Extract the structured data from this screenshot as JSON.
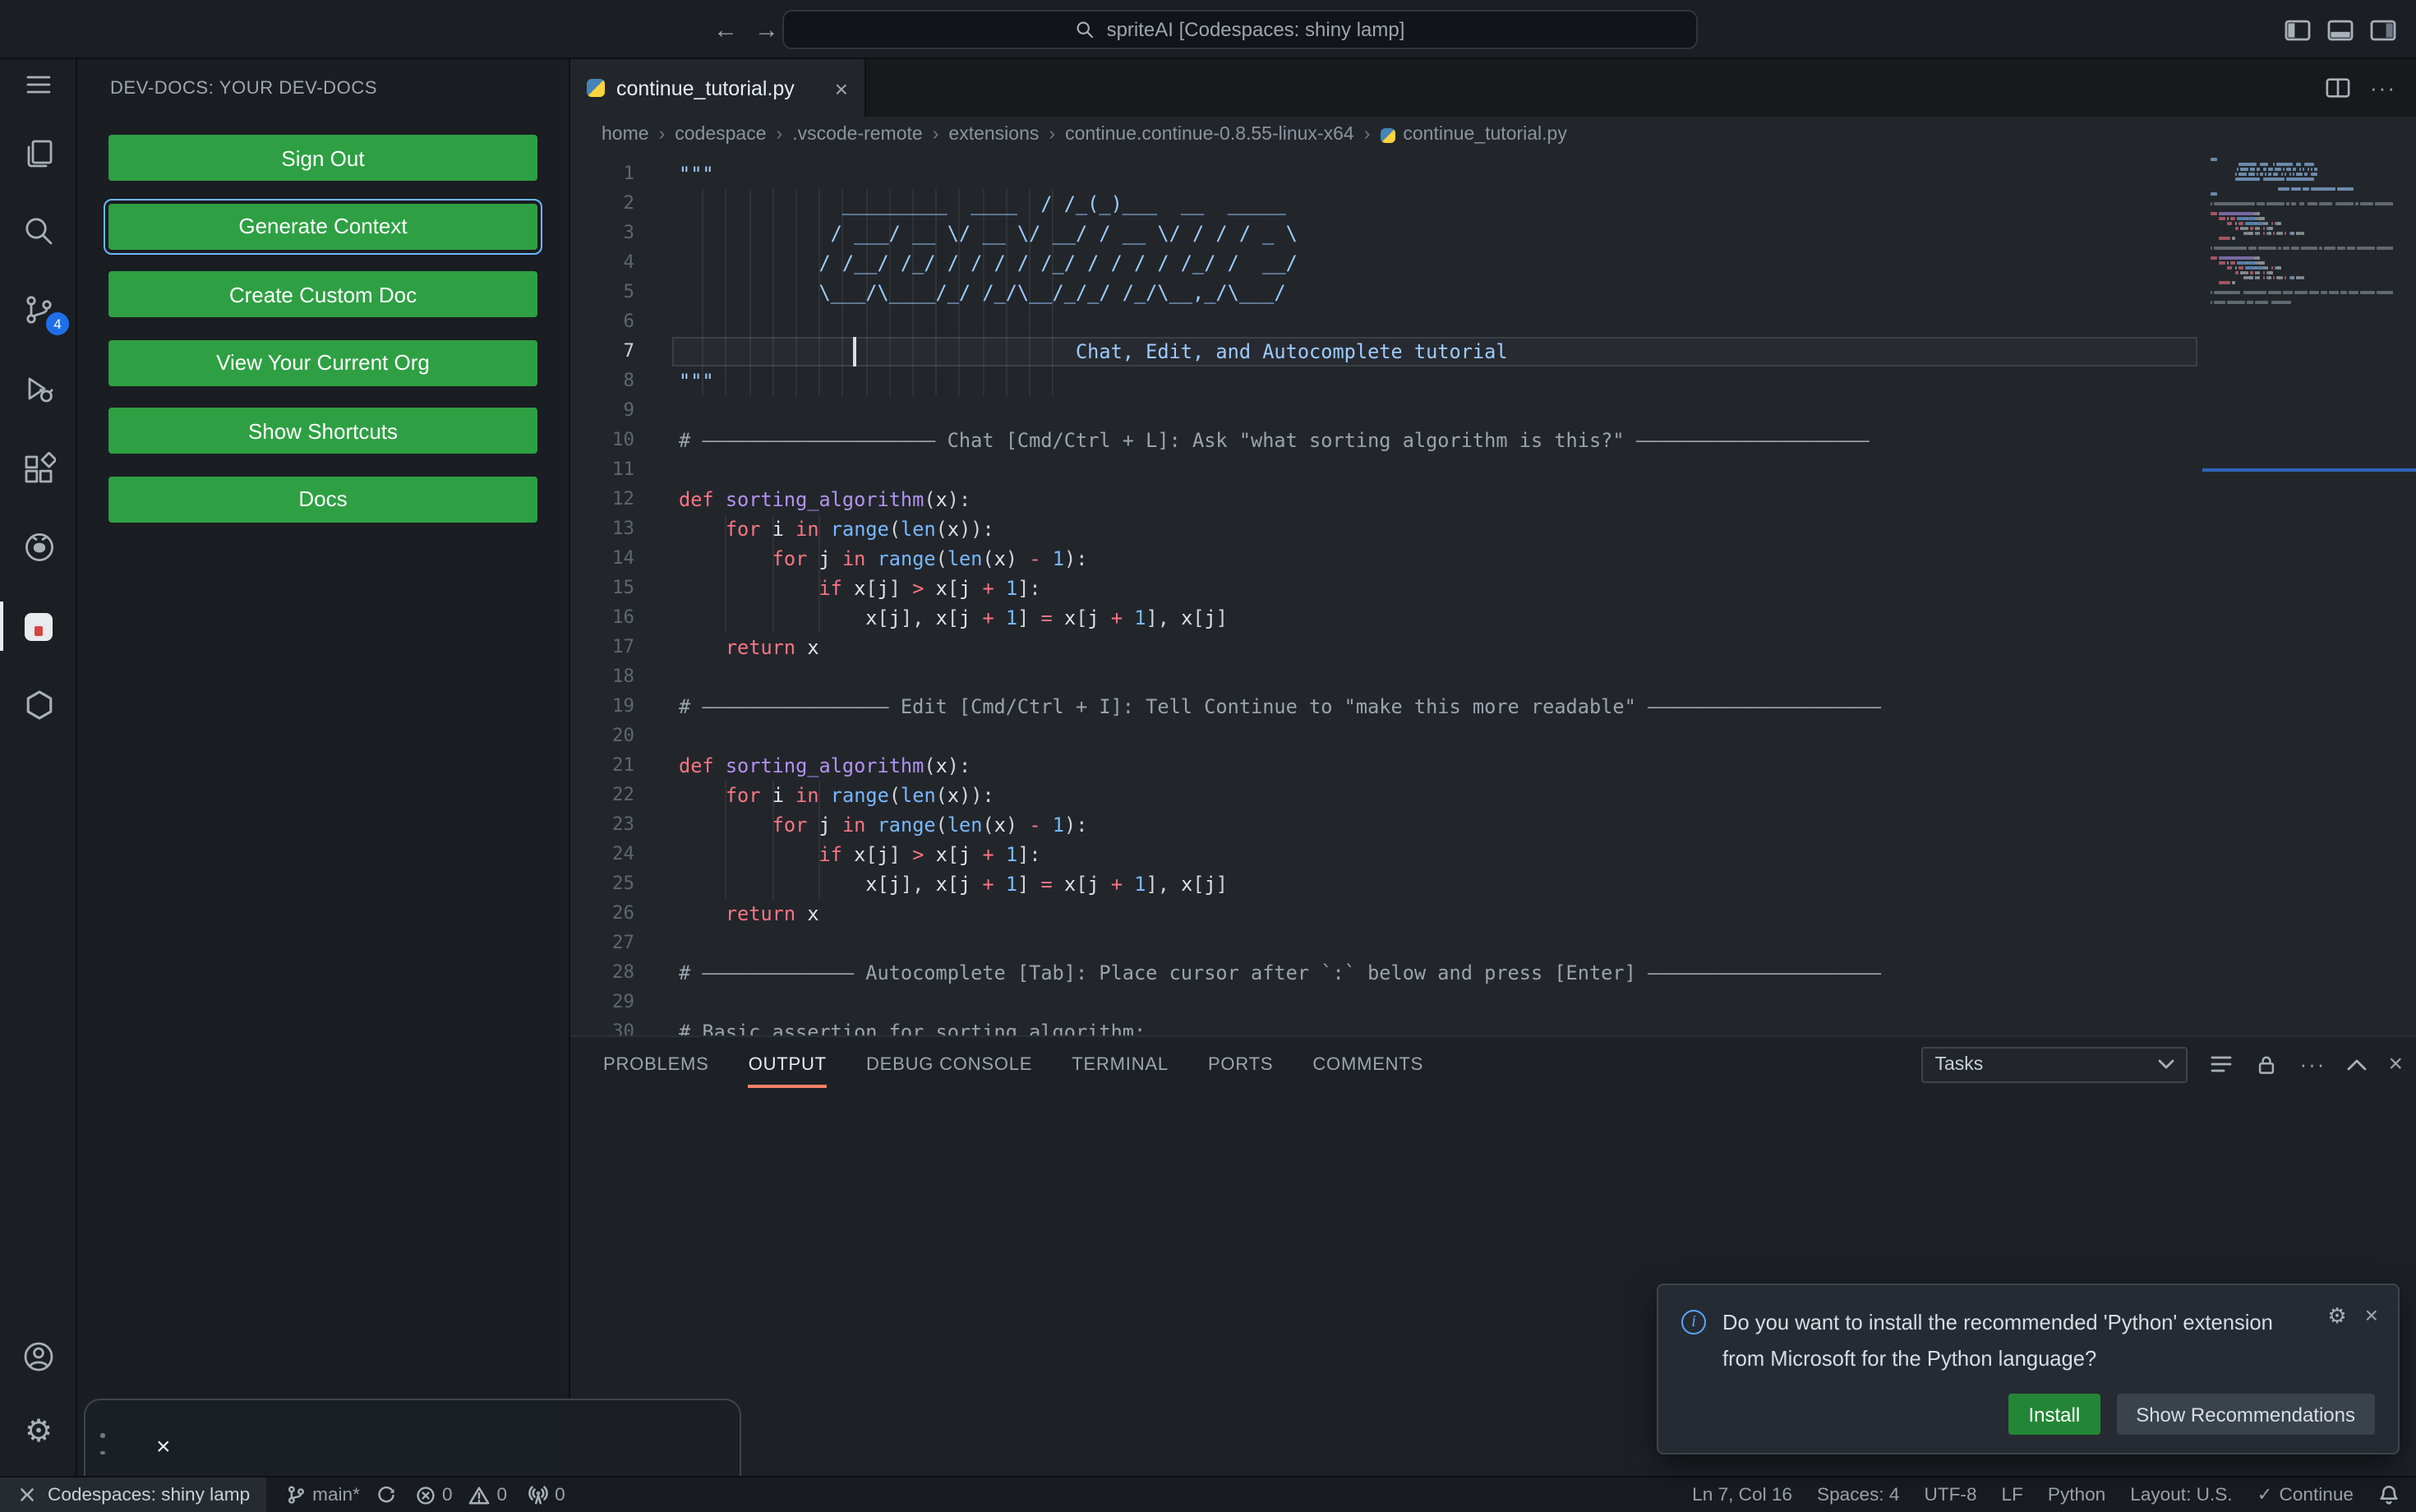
{
  "titlebar": {
    "search_value": "spriteAI [Codespaces: shiny lamp]"
  },
  "activity_bar": {
    "scm_badge": "4"
  },
  "sidebar": {
    "title": "DEV-DOCS: YOUR DEV-DOCS",
    "buttons": [
      "Sign Out",
      "Generate Context",
      "Create Custom Doc",
      "View Your Current Org",
      "Show Shortcuts",
      "Docs"
    ],
    "focused_index": 1
  },
  "editor": {
    "tab_label": "continue_tutorial.py",
    "breadcrumbs": [
      "home",
      "codespace",
      ".vscode-remote",
      "extensions",
      "continue.continue-0.8.55-linux-x64",
      "continue_tutorial.py"
    ],
    "active_line": 7,
    "cursor": {
      "line": 7,
      "col": 16
    },
    "lines": [
      [
        [
          "s",
          "\"\"\""
        ]
      ],
      [
        [
          "s",
          "              _________  ____  / /_(_)___  __  _____"
        ]
      ],
      [
        [
          "s",
          "             / ___/ __ \\/ __ \\/ __/ / __ \\/ / / / _ \\"
        ]
      ],
      [
        [
          "s",
          "            / /__/ /_/ / / / / /_/ / / / / /_/ /  __/"
        ]
      ],
      [
        [
          "s",
          "            \\___/\\____/_/ /_/\\__/_/_/ /_/\\__,_/\\___/"
        ]
      ],
      [],
      [
        [
          "s",
          "                                  Chat, Edit, and Autocomplete tutorial"
        ]
      ],
      [
        [
          "s",
          "\"\"\""
        ]
      ],
      [],
      [
        [
          "c",
          "# ———————————————————— Chat [Cmd/Ctrl + L]: Ask \"what sorting algorithm is this?\" ————————————————————"
        ]
      ],
      [],
      [
        [
          "k",
          "def"
        ],
        [
          "p",
          " "
        ],
        [
          "f",
          "sorting_algorithm"
        ],
        [
          "p",
          "("
        ],
        [
          "v",
          "x"
        ],
        [
          "p",
          "):"
        ]
      ],
      [
        [
          "p",
          "    "
        ],
        [
          "k",
          "for"
        ],
        [
          "p",
          " "
        ],
        [
          "v",
          "i"
        ],
        [
          "p",
          " "
        ],
        [
          "k",
          "in"
        ],
        [
          "p",
          " "
        ],
        [
          "b",
          "range"
        ],
        [
          "p",
          "("
        ],
        [
          "b",
          "len"
        ],
        [
          "p",
          "("
        ],
        [
          "v",
          "x"
        ],
        [
          "p",
          ")):"
        ]
      ],
      [
        [
          "p",
          "        "
        ],
        [
          "k",
          "for"
        ],
        [
          "p",
          " "
        ],
        [
          "v",
          "j"
        ],
        [
          "p",
          " "
        ],
        [
          "k",
          "in"
        ],
        [
          "p",
          " "
        ],
        [
          "b",
          "range"
        ],
        [
          "p",
          "("
        ],
        [
          "b",
          "len"
        ],
        [
          "p",
          "("
        ],
        [
          "v",
          "x"
        ],
        [
          "p",
          ") "
        ],
        [
          "o",
          "-"
        ],
        [
          "p",
          " "
        ],
        [
          "n",
          "1"
        ],
        [
          "p",
          "):"
        ]
      ],
      [
        [
          "p",
          "            "
        ],
        [
          "k",
          "if"
        ],
        [
          "p",
          " "
        ],
        [
          "v",
          "x"
        ],
        [
          "p",
          "["
        ],
        [
          "v",
          "j"
        ],
        [
          "p",
          "] "
        ],
        [
          "o",
          ">"
        ],
        [
          "p",
          " "
        ],
        [
          "v",
          "x"
        ],
        [
          "p",
          "["
        ],
        [
          "v",
          "j"
        ],
        [
          "p",
          " "
        ],
        [
          "o",
          "+"
        ],
        [
          "p",
          " "
        ],
        [
          "n",
          "1"
        ],
        [
          "p",
          "]:"
        ]
      ],
      [
        [
          "p",
          "                "
        ],
        [
          "v",
          "x"
        ],
        [
          "p",
          "["
        ],
        [
          "v",
          "j"
        ],
        [
          "p",
          "], "
        ],
        [
          "v",
          "x"
        ],
        [
          "p",
          "["
        ],
        [
          "v",
          "j"
        ],
        [
          "p",
          " "
        ],
        [
          "o",
          "+"
        ],
        [
          "p",
          " "
        ],
        [
          "n",
          "1"
        ],
        [
          "p",
          "] "
        ],
        [
          "o",
          "="
        ],
        [
          "p",
          " "
        ],
        [
          "v",
          "x"
        ],
        [
          "p",
          "["
        ],
        [
          "v",
          "j"
        ],
        [
          "p",
          " "
        ],
        [
          "o",
          "+"
        ],
        [
          "p",
          " "
        ],
        [
          "n",
          "1"
        ],
        [
          "p",
          "], "
        ],
        [
          "v",
          "x"
        ],
        [
          "p",
          "["
        ],
        [
          "v",
          "j"
        ],
        [
          "p",
          "]"
        ]
      ],
      [
        [
          "p",
          "    "
        ],
        [
          "k",
          "return"
        ],
        [
          "p",
          " "
        ],
        [
          "v",
          "x"
        ]
      ],
      [],
      [
        [
          "c",
          "# ———————————————— Edit [Cmd/Ctrl + I]: Tell Continue to \"make this more readable\" ————————————————————"
        ]
      ],
      [],
      [
        [
          "k",
          "def"
        ],
        [
          "p",
          " "
        ],
        [
          "f",
          "sorting_algorithm"
        ],
        [
          "p",
          "("
        ],
        [
          "v",
          "x"
        ],
        [
          "p",
          "):"
        ]
      ],
      [
        [
          "p",
          "    "
        ],
        [
          "k",
          "for"
        ],
        [
          "p",
          " "
        ],
        [
          "v",
          "i"
        ],
        [
          "p",
          " "
        ],
        [
          "k",
          "in"
        ],
        [
          "p",
          " "
        ],
        [
          "b",
          "range"
        ],
        [
          "p",
          "("
        ],
        [
          "b",
          "len"
        ],
        [
          "p",
          "("
        ],
        [
          "v",
          "x"
        ],
        [
          "p",
          ")):"
        ]
      ],
      [
        [
          "p",
          "        "
        ],
        [
          "k",
          "for"
        ],
        [
          "p",
          " "
        ],
        [
          "v",
          "j"
        ],
        [
          "p",
          " "
        ],
        [
          "k",
          "in"
        ],
        [
          "p",
          " "
        ],
        [
          "b",
          "range"
        ],
        [
          "p",
          "("
        ],
        [
          "b",
          "len"
        ],
        [
          "p",
          "("
        ],
        [
          "v",
          "x"
        ],
        [
          "p",
          ") "
        ],
        [
          "o",
          "-"
        ],
        [
          "p",
          " "
        ],
        [
          "n",
          "1"
        ],
        [
          "p",
          "):"
        ]
      ],
      [
        [
          "p",
          "            "
        ],
        [
          "k",
          "if"
        ],
        [
          "p",
          " "
        ],
        [
          "v",
          "x"
        ],
        [
          "p",
          "["
        ],
        [
          "v",
          "j"
        ],
        [
          "p",
          "] "
        ],
        [
          "o",
          ">"
        ],
        [
          "p",
          " "
        ],
        [
          "v",
          "x"
        ],
        [
          "p",
          "["
        ],
        [
          "v",
          "j"
        ],
        [
          "p",
          " "
        ],
        [
          "o",
          "+"
        ],
        [
          "p",
          " "
        ],
        [
          "n",
          "1"
        ],
        [
          "p",
          "]:"
        ]
      ],
      [
        [
          "p",
          "                "
        ],
        [
          "v",
          "x"
        ],
        [
          "p",
          "["
        ],
        [
          "v",
          "j"
        ],
        [
          "p",
          "], "
        ],
        [
          "v",
          "x"
        ],
        [
          "p",
          "["
        ],
        [
          "v",
          "j"
        ],
        [
          "p",
          " "
        ],
        [
          "o",
          "+"
        ],
        [
          "p",
          " "
        ],
        [
          "n",
          "1"
        ],
        [
          "p",
          "] "
        ],
        [
          "o",
          "="
        ],
        [
          "p",
          " "
        ],
        [
          "v",
          "x"
        ],
        [
          "p",
          "["
        ],
        [
          "v",
          "j"
        ],
        [
          "p",
          " "
        ],
        [
          "o",
          "+"
        ],
        [
          "p",
          " "
        ],
        [
          "n",
          "1"
        ],
        [
          "p",
          "], "
        ],
        [
          "v",
          "x"
        ],
        [
          "p",
          "["
        ],
        [
          "v",
          "j"
        ],
        [
          "p",
          "]"
        ]
      ],
      [
        [
          "p",
          "    "
        ],
        [
          "k",
          "return"
        ],
        [
          "p",
          " "
        ],
        [
          "v",
          "x"
        ]
      ],
      [],
      [
        [
          "c",
          "# ————————————— Autocomplete [Tab]: Place cursor after `:` below and press [Enter] ————————————————————"
        ]
      ],
      [],
      [
        [
          "c",
          "# Basic assertion for sorting algorithm:"
        ]
      ]
    ]
  },
  "panel": {
    "tabs": [
      "PROBLEMS",
      "OUTPUT",
      "DEBUG CONSOLE",
      "TERMINAL",
      "PORTS",
      "COMMENTS"
    ],
    "active_tab": "OUTPUT",
    "tasks_dropdown": "Tasks"
  },
  "notification": {
    "lines": [
      "Do you want to install the recommended 'Python' extension",
      "from Microsoft for the Python language?"
    ],
    "buttons": {
      "install": "Install",
      "show_recommendations": "Show Recommendations"
    }
  },
  "statusbar": {
    "remote": "Codespaces: shiny lamp",
    "branch": "main*",
    "errors": "0",
    "warnings": "0",
    "ports": "0",
    "line_col": "Ln 7, Col 16",
    "indentation": "Spaces: 4",
    "encoding": "UTF-8",
    "eol": "LF",
    "language": "Python",
    "keyboard_layout": "Layout: U.S.",
    "continue_label": "Continue"
  },
  "colors": {
    "button_green": "#2ea043",
    "install_green": "#238636",
    "focus_blue": "#6cb6ff",
    "panel_active_underline": "#f78166",
    "scm_badge_blue": "#1f6feb",
    "info_blue": "#58a6ff"
  }
}
